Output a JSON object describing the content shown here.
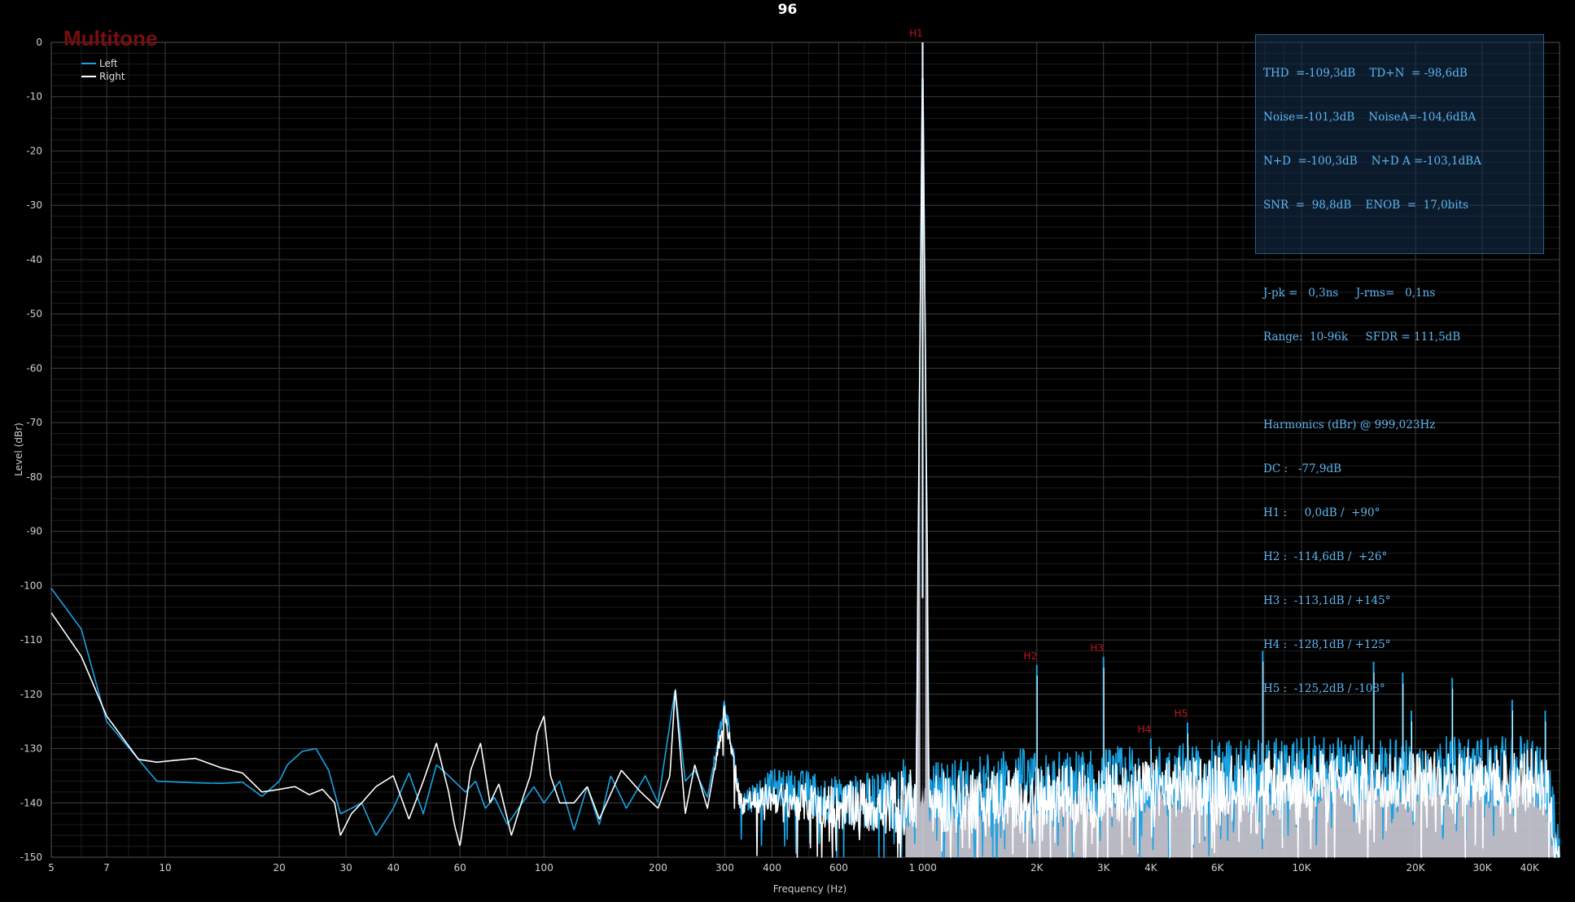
{
  "title": "96",
  "brand": "Multitone",
  "legend": [
    {
      "name": "Left",
      "color": "#19a3e3"
    },
    {
      "name": "Right",
      "color": "#ffffff"
    }
  ],
  "colors": {
    "background": "#000000",
    "grid_major": "#3a3a3a",
    "grid_minor": "#1c1c1c",
    "harmonic_label": "#c0141b",
    "noise_fill": "#d9d9e6",
    "stats_text": "#5db5ef"
  },
  "stats": {
    "lines": [
      "THD  =-109,3dB    TD+N  = -98,6dB",
      "Noise=-101,3dB    NoiseA=-104,6dBA",
      "N+D  =-100,3dB    N+D A =-103,1dBA",
      "SNR  =  98,8dB    ENOB  =  17,0bits",
      "",
      "J-pk =   0,3ns     J-rms=   0,1ns",
      "Range:  10-96k     SFDR = 111,5dB",
      "",
      "Harmonics (dBr) @ 999,023Hz",
      "DC :   -77,9dB",
      "H1 :     0,0dB /  +90°",
      "H2 :  -114,6dB /  +26°",
      "H3 :  -113,1dB / +145°",
      "H4 :  -128,1dB / +125°",
      "H5 :  -125,2dB / -108°"
    ]
  },
  "chart_data": {
    "type": "line",
    "title": "96",
    "xlabel": "Frequency (Hz)",
    "ylabel": "Level (dBr)",
    "xscale": "log",
    "xlim": [
      5,
      48000
    ],
    "ylim": [
      -150,
      0
    ],
    "grid": true,
    "legend_position": "top-left",
    "x_ticks": [
      {
        "v": 5,
        "label": "5"
      },
      {
        "v": 7,
        "label": "7"
      },
      {
        "v": 10,
        "label": "10"
      },
      {
        "v": 20,
        "label": "20"
      },
      {
        "v": 30,
        "label": "30"
      },
      {
        "v": 40,
        "label": "40"
      },
      {
        "v": 60,
        "label": "60"
      },
      {
        "v": 100,
        "label": "100"
      },
      {
        "v": 200,
        "label": "200"
      },
      {
        "v": 300,
        "label": "300"
      },
      {
        "v": 400,
        "label": "400"
      },
      {
        "v": 600,
        "label": "600"
      },
      {
        "v": 1000,
        "label": "1 000"
      },
      {
        "v": 2000,
        "label": "2K"
      },
      {
        "v": 3000,
        "label": "3K"
      },
      {
        "v": 4000,
        "label": "4K"
      },
      {
        "v": 6000,
        "label": "6K"
      },
      {
        "v": 10000,
        "label": "10K"
      },
      {
        "v": 20000,
        "label": "20K"
      },
      {
        "v": 30000,
        "label": "30K"
      },
      {
        "v": 40000,
        "label": "40K"
      }
    ],
    "y_ticks": [
      {
        "v": 0,
        "label": "0"
      },
      {
        "v": -10,
        "label": "-10"
      },
      {
        "v": -20,
        "label": "-20"
      },
      {
        "v": -30,
        "label": "-30"
      },
      {
        "v": -40,
        "label": "-40"
      },
      {
        "v": -50,
        "label": "-50"
      },
      {
        "v": -60,
        "label": "-60"
      },
      {
        "v": -70,
        "label": "-70"
      },
      {
        "v": -80,
        "label": "-80"
      },
      {
        "v": -90,
        "label": "-90"
      },
      {
        "v": -100,
        "label": "-100"
      },
      {
        "v": -110,
        "label": "-110"
      },
      {
        "v": -120,
        "label": "-120"
      },
      {
        "v": -130,
        "label": "-130"
      },
      {
        "v": -140,
        "label": "-140"
      },
      {
        "v": -150,
        "label": "-150"
      }
    ],
    "series": [
      {
        "name": "Left",
        "color": "#19a3e3",
        "points": [
          [
            5,
            -100.5
          ],
          [
            6,
            -108
          ],
          [
            7,
            -125
          ],
          [
            8.5,
            -132
          ],
          [
            9.5,
            -136
          ],
          [
            12,
            -136.3
          ],
          [
            14,
            -136.4
          ],
          [
            16,
            -136.2
          ],
          [
            18,
            -138.8
          ],
          [
            20,
            -136
          ],
          [
            21,
            -133
          ],
          [
            23,
            -130.5
          ],
          [
            25,
            -130
          ],
          [
            27,
            -134
          ],
          [
            29,
            -142
          ],
          [
            31,
            -141
          ],
          [
            33,
            -140
          ],
          [
            36,
            -146
          ],
          [
            40,
            -141
          ],
          [
            44,
            -134.5
          ],
          [
            48,
            -142
          ],
          [
            52,
            -133
          ],
          [
            56,
            -135
          ],
          [
            62,
            -138
          ],
          [
            66,
            -136
          ],
          [
            70,
            -141
          ],
          [
            74,
            -139
          ],
          [
            80,
            -144
          ],
          [
            86,
            -140.8
          ],
          [
            94,
            -137
          ],
          [
            100,
            -140
          ],
          [
            110,
            -136
          ],
          [
            120,
            -145
          ],
          [
            130,
            -137
          ],
          [
            140,
            -144
          ],
          [
            150,
            -135
          ],
          [
            165,
            -141
          ],
          [
            185,
            -135
          ],
          [
            200,
            -140
          ],
          [
            222,
            -119
          ],
          [
            236,
            -136
          ],
          [
            250,
            -134
          ],
          [
            270,
            -139
          ],
          [
            300,
            -122
          ],
          [
            330,
            -140
          ],
          [
            400,
            -137
          ],
          [
            500,
            -138
          ],
          [
            600,
            -140
          ],
          [
            700,
            -140
          ],
          [
            800,
            -139
          ],
          [
            900,
            -138
          ],
          [
            960,
            -139
          ],
          [
            999,
            -0.2
          ],
          [
            1040,
            -139
          ],
          [
            1200,
            -138
          ],
          [
            1500,
            -137
          ],
          [
            1800,
            -136
          ],
          [
            2000,
            -137
          ],
          [
            3000,
            -136
          ],
          [
            5000,
            -135
          ],
          [
            8000,
            -134
          ],
          [
            12000,
            -134
          ],
          [
            20000,
            -134
          ],
          [
            30000,
            -134
          ],
          [
            40000,
            -134
          ],
          [
            44000,
            -135
          ],
          [
            48000,
            -150
          ]
        ],
        "spurs": [
          [
            999.023,
            0
          ],
          [
            2000,
            -114.6
          ],
          [
            3000,
            -113.1
          ],
          [
            4000,
            -128.1
          ],
          [
            5000,
            -125.2
          ],
          [
            7900,
            -112
          ],
          [
            15500,
            -114
          ],
          [
            18500,
            -116
          ],
          [
            19500,
            -123
          ],
          [
            25000,
            -117
          ],
          [
            28500,
            -130
          ],
          [
            36000,
            -121
          ],
          [
            44000,
            -123
          ]
        ]
      },
      {
        "name": "Right",
        "color": "#ffffff",
        "points": [
          [
            5,
            -105
          ],
          [
            6,
            -113
          ],
          [
            7,
            -124
          ],
          [
            8.5,
            -132
          ],
          [
            9.5,
            -132.5
          ],
          [
            12,
            -131.8
          ],
          [
            14,
            -133.5
          ],
          [
            16,
            -134.5
          ],
          [
            18,
            -138
          ],
          [
            20,
            -137.5
          ],
          [
            22,
            -137
          ],
          [
            24,
            -138.5
          ],
          [
            26,
            -137.5
          ],
          [
            28,
            -140
          ],
          [
            29,
            -146
          ],
          [
            31,
            -142
          ],
          [
            33,
            -140
          ],
          [
            36,
            -137
          ],
          [
            40,
            -135
          ],
          [
            44,
            -143
          ],
          [
            48,
            -136
          ],
          [
            52,
            -129
          ],
          [
            56,
            -138
          ],
          [
            58,
            -144
          ],
          [
            60,
            -148
          ],
          [
            64,
            -134
          ],
          [
            68,
            -129
          ],
          [
            72,
            -140
          ],
          [
            76,
            -136.5
          ],
          [
            82,
            -146
          ],
          [
            88,
            -139
          ],
          [
            92,
            -135
          ],
          [
            96,
            -127
          ],
          [
            100,
            -124
          ],
          [
            104,
            -135
          ],
          [
            110,
            -140
          ],
          [
            120,
            -140
          ],
          [
            130,
            -137
          ],
          [
            140,
            -143
          ],
          [
            160,
            -134
          ],
          [
            180,
            -138
          ],
          [
            200,
            -141
          ],
          [
            215,
            -135
          ],
          [
            222,
            -119
          ],
          [
            236,
            -142
          ],
          [
            250,
            -133
          ],
          [
            270,
            -141
          ],
          [
            300,
            -123
          ],
          [
            330,
            -140
          ],
          [
            400,
            -139
          ],
          [
            500,
            -140
          ],
          [
            600,
            -141
          ],
          [
            700,
            -140
          ],
          [
            800,
            -141
          ],
          [
            900,
            -139
          ],
          [
            960,
            -139
          ],
          [
            999,
            0
          ],
          [
            1040,
            -140
          ],
          [
            1200,
            -140
          ],
          [
            1500,
            -139
          ],
          [
            1800,
            -139
          ],
          [
            2000,
            -139
          ],
          [
            3000,
            -138
          ],
          [
            5000,
            -137
          ],
          [
            8000,
            -136
          ],
          [
            12000,
            -136
          ],
          [
            20000,
            -135.5
          ],
          [
            30000,
            -135.5
          ],
          [
            40000,
            -135.5
          ],
          [
            44000,
            -136
          ],
          [
            48000,
            -150
          ]
        ]
      }
    ],
    "harmonic_labels": [
      {
        "label": "H1",
        "x": 999.023,
        "y": 0
      },
      {
        "label": "H2",
        "x": 2000,
        "y": -114.6
      },
      {
        "label": "H3",
        "x": 3000,
        "y": -113.1
      },
      {
        "label": "H4",
        "x": 4000,
        "y": -128.1
      },
      {
        "label": "H5",
        "x": 5000,
        "y": -125.2
      }
    ]
  }
}
